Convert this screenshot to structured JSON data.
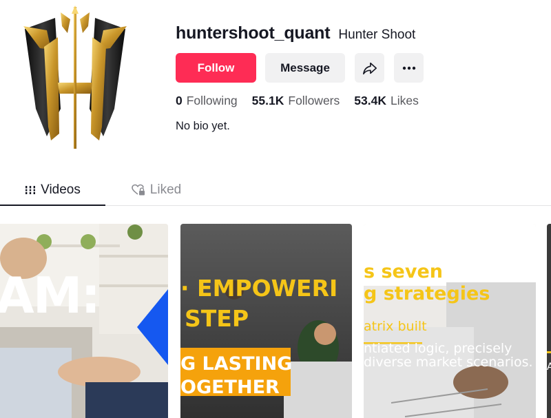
{
  "profile": {
    "username": "huntershoot_quant",
    "nickname": "Hunter Shoot",
    "avatar_icon": "hunter-shoot-logo-icon",
    "bio": "No bio yet."
  },
  "actions": {
    "follow_label": "Follow",
    "message_label": "Message",
    "share_icon": "share-icon",
    "more_icon": "more-options-icon"
  },
  "stats": [
    {
      "value": "0",
      "label": "Following"
    },
    {
      "value": "55.1K",
      "label": "Followers"
    },
    {
      "value": "53.4K",
      "label": "Likes"
    }
  ],
  "tabs": [
    {
      "label": "Videos",
      "icon": "grid-icon",
      "active": true
    },
    {
      "label": "Liked",
      "icon": "liked-lock-icon",
      "active": false
    }
  ],
  "videos": [
    {
      "overlay_lines": [
        "AM:"
      ]
    },
    {
      "overlay_lines": [
        "· EMPOWERI",
        "STEP",
        "G LASTING",
        "OGETHER"
      ]
    },
    {
      "overlay_lines": [
        "s seven",
        "g strategies",
        "atrix built",
        "ntiated logic, precisely",
        "diverse market scenarios."
      ]
    },
    {
      "overlay_lines": [
        "A"
      ]
    }
  ],
  "colors": {
    "brand": "#fe2c55",
    "text_primary": "#161823",
    "text_secondary": "#58595e",
    "button_gray": "#f1f1f2",
    "tab_inactive": "#8a8b91",
    "accent_yellow": "#f5c518"
  }
}
